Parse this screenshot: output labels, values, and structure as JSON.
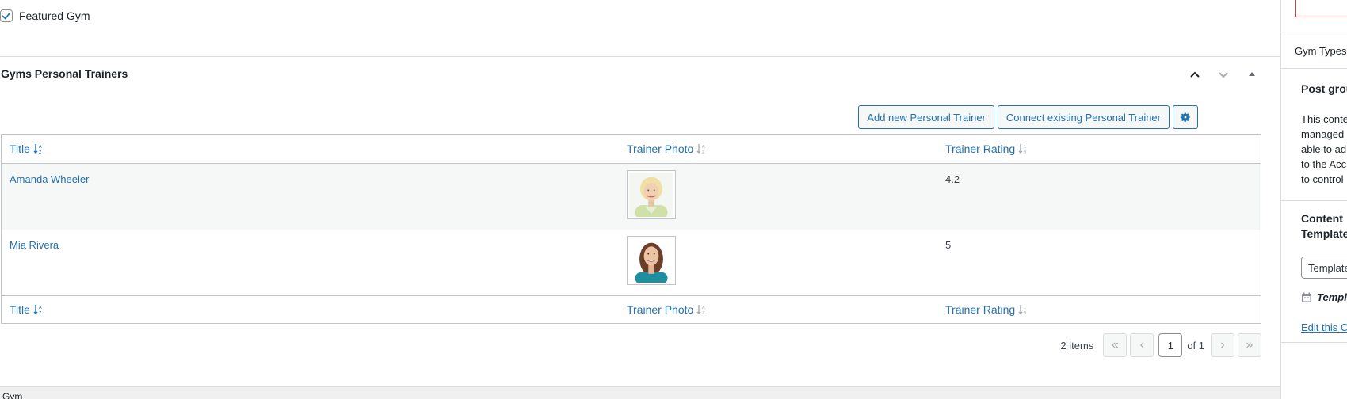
{
  "featured": {
    "label": "Featured Gym",
    "checked": true
  },
  "metabox": {
    "title": "Gyms Personal Trainers",
    "handle_icons": [
      "chevron-up-icon",
      "chevron-down-icon",
      "triangle-up-icon"
    ]
  },
  "toolbar": {
    "add_label": "Add new Personal Trainer",
    "connect_label": "Connect existing Personal Trainer",
    "settings_icon": "gear-icon"
  },
  "table": {
    "columns": [
      {
        "label": "Title",
        "sort_icon": "sort-alpha-desc-icon"
      },
      {
        "label": "Trainer Photo",
        "sort_icon": "sort-alpha-icon"
      },
      {
        "label": "Trainer Rating",
        "sort_icon": "sort-numeric-icon"
      }
    ],
    "rows": [
      {
        "title": "Amanda Wheeler",
        "photo_alt": "portrait-blonde",
        "rating": "4.2"
      },
      {
        "title": "Mia Rivera",
        "photo_alt": "portrait-brunette",
        "rating": "5"
      }
    ]
  },
  "pagination": {
    "items_count": "2 items",
    "first": "«",
    "prev": "‹",
    "current_page": "1",
    "of_label": "of 1",
    "next": "›",
    "last": "»"
  },
  "bottom": {
    "label": "Gym"
  },
  "sidebar": {
    "gym_types": "Gym Types",
    "post_group_title": "Post grou",
    "post_group_text": [
      "This conte",
      "managed",
      "able to ad",
      "to the Acc",
      "to control"
    ],
    "content_template_title": [
      "Content",
      "Template"
    ],
    "template_select": "Template",
    "template_label": "Templ",
    "edit_link": "Edit this C"
  },
  "colors": {
    "link": "#2271b1",
    "border": "#c3c4c7",
    "error": "#d63638"
  }
}
